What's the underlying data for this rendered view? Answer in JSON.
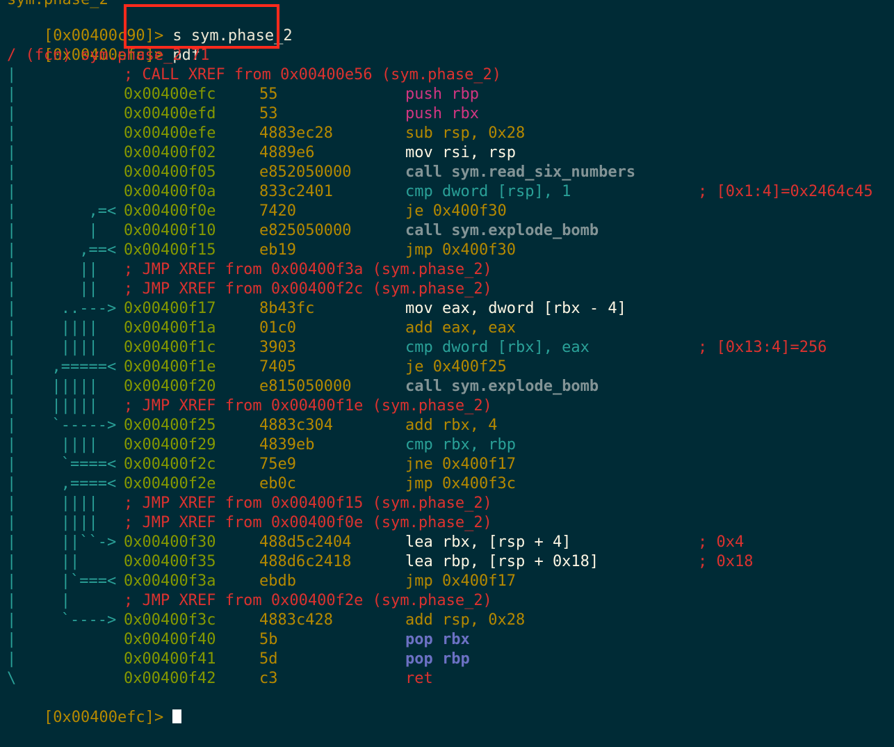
{
  "terminal": {
    "top_partial": "sym.phase_2",
    "prompts": [
      {
        "addr": "[0x00400c90]",
        "sep": ">",
        "cmd": " s sym.phase_2"
      },
      {
        "addr": "[0x00400efc]",
        "sep": ">",
        "cmd": " pdf"
      }
    ],
    "header": "/ (fcn) sym.phase_2 71",
    "lines": [
      {
        "kind": "xref",
        "gutter": "|",
        "flow": "",
        "text": "; CALL XREF from 0x00400e56 (sym.phase_2)"
      },
      {
        "kind": "ins",
        "gutter": "|",
        "flow": "",
        "addr": "0x00400efc",
        "bytes": "55",
        "mn": "push",
        "ops": "rbp",
        "cls": "m-push",
        "comment": ""
      },
      {
        "kind": "ins",
        "gutter": "|",
        "flow": "",
        "addr": "0x00400efd",
        "bytes": "53",
        "mn": "push",
        "ops": "rbx",
        "cls": "m-push",
        "comment": ""
      },
      {
        "kind": "ins",
        "gutter": "|",
        "flow": "",
        "addr": "0x00400efe",
        "bytes": "4883ec28",
        "mn": "sub",
        "ops": "rsp, 0x28",
        "cls": "m-arith",
        "comment": ""
      },
      {
        "kind": "ins",
        "gutter": "|",
        "flow": "",
        "addr": "0x00400f02",
        "bytes": "4889e6",
        "mn": "mov",
        "ops": "rsi, rsp",
        "cls": "m-mov",
        "comment": ""
      },
      {
        "kind": "ins",
        "gutter": "|",
        "flow": "",
        "addr": "0x00400f05",
        "bytes": "e852050000",
        "mn": "call",
        "ops": "sym.read_six_numbers",
        "cls": "m-call",
        "comment": ""
      },
      {
        "kind": "ins",
        "gutter": "|",
        "flow": "",
        "addr": "0x00400f0a",
        "bytes": "833c2401",
        "mn": "cmp",
        "ops": "dword [rsp], 1",
        "cls": "m-cmp",
        "comment": "; [0x1:4]=0x2464c45"
      },
      {
        "kind": "ins",
        "gutter": "|",
        "flow": "      ,=< ",
        "addr": "0x00400f0e",
        "bytes": "7420",
        "mn": "je",
        "ops": "0x400f30",
        "cls": "m-jmp",
        "comment": ""
      },
      {
        "kind": "ins",
        "gutter": "|",
        "flow": "      |   ",
        "addr": "0x00400f10",
        "bytes": "e825050000",
        "mn": "call",
        "ops": "sym.explode_bomb",
        "cls": "m-call",
        "comment": ""
      },
      {
        "kind": "ins",
        "gutter": "|",
        "flow": "     ,==< ",
        "addr": "0x00400f15",
        "bytes": "eb19",
        "mn": "jmp",
        "ops": "0x400f30",
        "cls": "m-jmp",
        "comment": ""
      },
      {
        "kind": "xref",
        "gutter": "|",
        "flow": "     ||   ",
        "text": "; JMP XREF from 0x00400f3a (sym.phase_2)"
      },
      {
        "kind": "xref",
        "gutter": "|",
        "flow": "     ||   ",
        "text": "; JMP XREF from 0x00400f2c (sym.phase_2)"
      },
      {
        "kind": "ins",
        "gutter": "|",
        "flow": "   ..---> ",
        "addr": "0x00400f17",
        "bytes": "8b43fc",
        "mn": "mov",
        "ops": "eax, dword [rbx - 4]",
        "cls": "m-mov",
        "comment": ""
      },
      {
        "kind": "ins",
        "gutter": "|",
        "flow": "   ||||   ",
        "addr": "0x00400f1a",
        "bytes": "01c0",
        "mn": "add",
        "ops": "eax, eax",
        "cls": "m-arith",
        "comment": ""
      },
      {
        "kind": "ins",
        "gutter": "|",
        "flow": "   ||||   ",
        "addr": "0x00400f1c",
        "bytes": "3903",
        "mn": "cmp",
        "ops": "dword [rbx], eax",
        "cls": "m-cmp",
        "comment": "; [0x13:4]=256"
      },
      {
        "kind": "ins",
        "gutter": "|",
        "flow": "  ,=====< ",
        "addr": "0x00400f1e",
        "bytes": "7405",
        "mn": "je",
        "ops": "0x400f25",
        "cls": "m-jmp",
        "comment": ""
      },
      {
        "kind": "ins",
        "gutter": "|",
        "flow": "  |||||   ",
        "addr": "0x00400f20",
        "bytes": "e815050000",
        "mn": "call",
        "ops": "sym.explode_bomb",
        "cls": "m-call",
        "comment": ""
      },
      {
        "kind": "xref",
        "gutter": "|",
        "flow": "  |||||   ",
        "text": "; JMP XREF from 0x00400f1e (sym.phase_2)"
      },
      {
        "kind": "ins",
        "gutter": "|",
        "flow": "  `-----> ",
        "addr": "0x00400f25",
        "bytes": "4883c304",
        "mn": "add",
        "ops": "rbx, 4",
        "cls": "m-arith",
        "comment": ""
      },
      {
        "kind": "ins",
        "gutter": "|",
        "flow": "   ||||   ",
        "addr": "0x00400f29",
        "bytes": "4839eb",
        "mn": "cmp",
        "ops": "rbx, rbp",
        "cls": "m-cmp",
        "comment": ""
      },
      {
        "kind": "ins",
        "gutter": "|",
        "flow": "   `====< ",
        "addr": "0x00400f2c",
        "bytes": "75e9",
        "mn": "jne",
        "ops": "0x400f17",
        "cls": "m-jmp",
        "comment": ""
      },
      {
        "kind": "ins",
        "gutter": "|",
        "flow": "   ,====< ",
        "addr": "0x00400f2e",
        "bytes": "eb0c",
        "mn": "jmp",
        "ops": "0x400f3c",
        "cls": "m-jmp",
        "comment": ""
      },
      {
        "kind": "xref",
        "gutter": "|",
        "flow": "   ||||   ",
        "text": "; JMP XREF from 0x00400f15 (sym.phase_2)"
      },
      {
        "kind": "xref",
        "gutter": "|",
        "flow": "   ||||   ",
        "text": "; JMP XREF from 0x00400f0e (sym.phase_2)"
      },
      {
        "kind": "ins",
        "gutter": "|",
        "flow": "   ||``-> ",
        "addr": "0x00400f30",
        "bytes": "488d5c2404",
        "mn": "lea",
        "ops": "rbx, [rsp + 4]",
        "cls": "m-lea",
        "comment": "; 0x4"
      },
      {
        "kind": "ins",
        "gutter": "|",
        "flow": "   ||     ",
        "addr": "0x00400f35",
        "bytes": "488d6c2418",
        "mn": "lea",
        "ops": "rbp, [rsp + 0x18]",
        "cls": "m-lea",
        "comment": "; 0x18"
      },
      {
        "kind": "ins",
        "gutter": "|",
        "flow": "   |`===< ",
        "addr": "0x00400f3a",
        "bytes": "ebdb",
        "mn": "jmp",
        "ops": "0x400f17",
        "cls": "m-jmp",
        "comment": ""
      },
      {
        "kind": "xref",
        "gutter": "|",
        "flow": "   |      ",
        "text": "; JMP XREF from 0x00400f2e (sym.phase_2)"
      },
      {
        "kind": "ins",
        "gutter": "|",
        "flow": "   `----> ",
        "addr": "0x00400f3c",
        "bytes": "4883c428",
        "mn": "add",
        "ops": "rsp, 0x28",
        "cls": "m-arith",
        "comment": ""
      },
      {
        "kind": "ins",
        "gutter": "|",
        "flow": "",
        "addr": "0x00400f40",
        "bytes": "5b",
        "mn": "pop",
        "ops": "rbx",
        "cls": "m-pop",
        "comment": ""
      },
      {
        "kind": "ins",
        "gutter": "|",
        "flow": "",
        "addr": "0x00400f41",
        "bytes": "5d",
        "mn": "pop",
        "ops": "rbp",
        "cls": "m-pop",
        "comment": ""
      },
      {
        "kind": "ins",
        "gutter": "\\",
        "flow": "",
        "addr": "0x00400f42",
        "bytes": "c3",
        "mn": "ret",
        "ops": "",
        "cls": "m-ret",
        "comment": ""
      }
    ],
    "final_prompt": {
      "addr": "[0x00400efc]",
      "sep": ">",
      "cmd": " "
    }
  }
}
